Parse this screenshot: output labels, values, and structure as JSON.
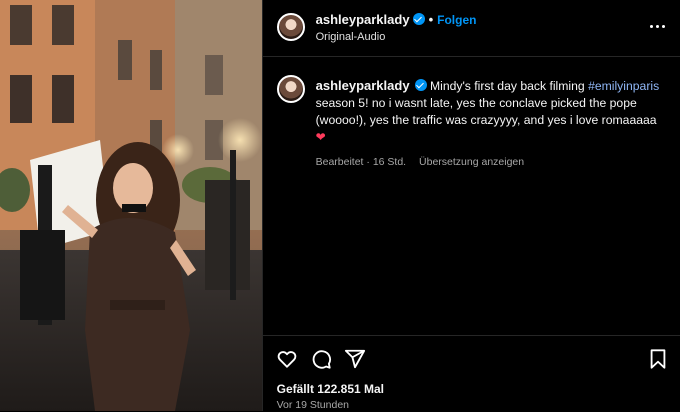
{
  "header": {
    "username": "ashleyparklady",
    "separator": "•",
    "follow_label": "Folgen",
    "audio_label": "Original-Audio"
  },
  "caption": {
    "username": "ashleyparklady",
    "text_before": "Mindy's first day back filming ",
    "hashtag": "#emilyinparis",
    "text_after": " season 5! no i wasnt late, yes the conclave picked the pope (woooo!), yes the traffic was crazyyyy, and yes i love romaaaaa ",
    "emoji": "❤",
    "edited_label": "Bearbeitet",
    "meta_sep": "·",
    "time": "16 Std.",
    "translate_label": "Übersetzung anzeigen"
  },
  "footer": {
    "likes": "Gefällt 122.851 Mal",
    "posted_ago": "Vor 19 Stunden"
  },
  "icons": [
    "more-options-icon",
    "heart-icon",
    "comment-icon",
    "share-icon",
    "bookmark-icon",
    "verified-badge-icon"
  ],
  "colors": {
    "accent": "#0095f6",
    "hashtag": "#8fb6f5",
    "background": "#000000",
    "heart": "#ff3b5c"
  }
}
